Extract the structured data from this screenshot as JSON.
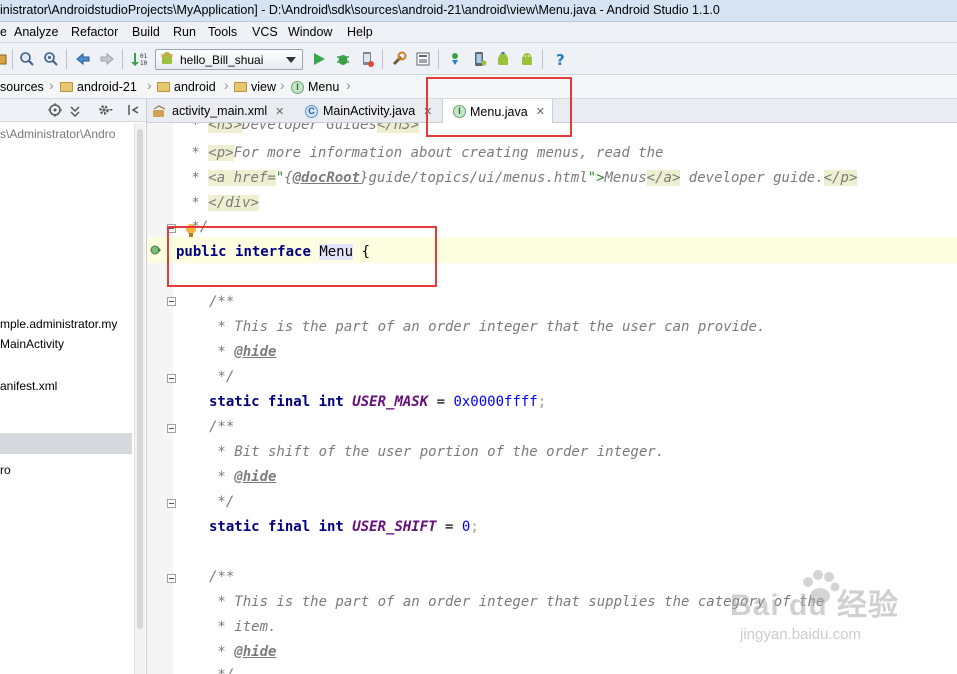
{
  "window": {
    "title": "inistrator\\AndroidstudioProjects\\MyApplication] - D:\\Android\\sdk\\sources\\android-21\\android\\view\\Menu.java - Android Studio 1.1.0"
  },
  "menubar": {
    "items": [
      "Analyze",
      "Refactor",
      "Build",
      "Run",
      "Tools",
      "VCS",
      "Window",
      "Help"
    ]
  },
  "toolbar": {
    "run_config": "hello_Bill_shuai"
  },
  "breadcrumb": {
    "items": [
      "sources",
      "android-21",
      "android",
      "view",
      "Menu"
    ]
  },
  "project_panel": {
    "path": "s\\Administrator\\Andro",
    "items": [
      "mple.administrator.my",
      "MainActivity",
      "anifest.xml",
      "ro"
    ]
  },
  "tabs": [
    {
      "label": "activity_main.xml",
      "icon": "xml-file-icon",
      "active": false
    },
    {
      "label": "MainActivity.java",
      "icon": "class-icon",
      "active": false
    },
    {
      "label": "Menu.java",
      "icon": "interface-icon",
      "active": true
    }
  ],
  "editor": {
    "lines": {
      "l1_star": " * ",
      "l1_open": "<h3>",
      "l1_text": "Developer Guides",
      "l1_close": "</h3>",
      "l2_star": " * ",
      "l2_tag": "<p>",
      "l2_text": "For more information about creating menus, read the",
      "l3_star": " * ",
      "l3_tag_open": "<a href=",
      "l3_q1": "\"",
      "l3_brace_open": "{",
      "l3_docroot": "@docRoot",
      "l3_brace_close": "}",
      "l3_path": "guide/topics/ui/menus.html",
      "l3_q2": "\">",
      "l3_link": "Menus",
      "l3_a_close": "</a>",
      "l3_text": " developer guide.",
      "l3_p_close": "</p>",
      "l4_star": " * ",
      "l4_div": "</div>",
      "l5": " */",
      "decl_kw1": "public",
      "decl_kw2": "interface",
      "decl_name": "Menu",
      "decl_brace": " {",
      "c1_open": "/**",
      "c1_line": " * This is the part of an order integer that the user can provide.",
      "c1_hide_star": " * ",
      "c1_hide": "@hide",
      "c1_close": " */",
      "f1_kw": "static final int",
      "f1_name": "USER_MASK",
      "f1_eq": " = ",
      "f1_val": "0x0000ffff",
      "f1_semi": ";",
      "c2_open": "/**",
      "c2_line": " * Bit shift of the user portion of the order integer.",
      "c2_hide_star": " * ",
      "c2_hide": "@hide",
      "c2_close": " */",
      "f2_kw": "static final int",
      "f2_name": "USER_SHIFT",
      "f2_eq": " = ",
      "f2_val": "0",
      "f2_semi": ";",
      "c3_open": "/**",
      "c3_line1": " * This is the part of an order integer that supplies the category of the",
      "c3_line2": " * item.",
      "c3_hide_star": " * ",
      "c3_hide": "@hide",
      "c3_close": " */"
    }
  },
  "watermark": {
    "brand": "Bai du 经验",
    "url": "jingyan.baidu.com"
  },
  "colors": {
    "highlight_box": "#e53a3a",
    "keyword": "#000080",
    "field": "#660e7a",
    "number": "#0000ff",
    "comment": "#7b7b7b",
    "current_line": "#fdfde0"
  }
}
